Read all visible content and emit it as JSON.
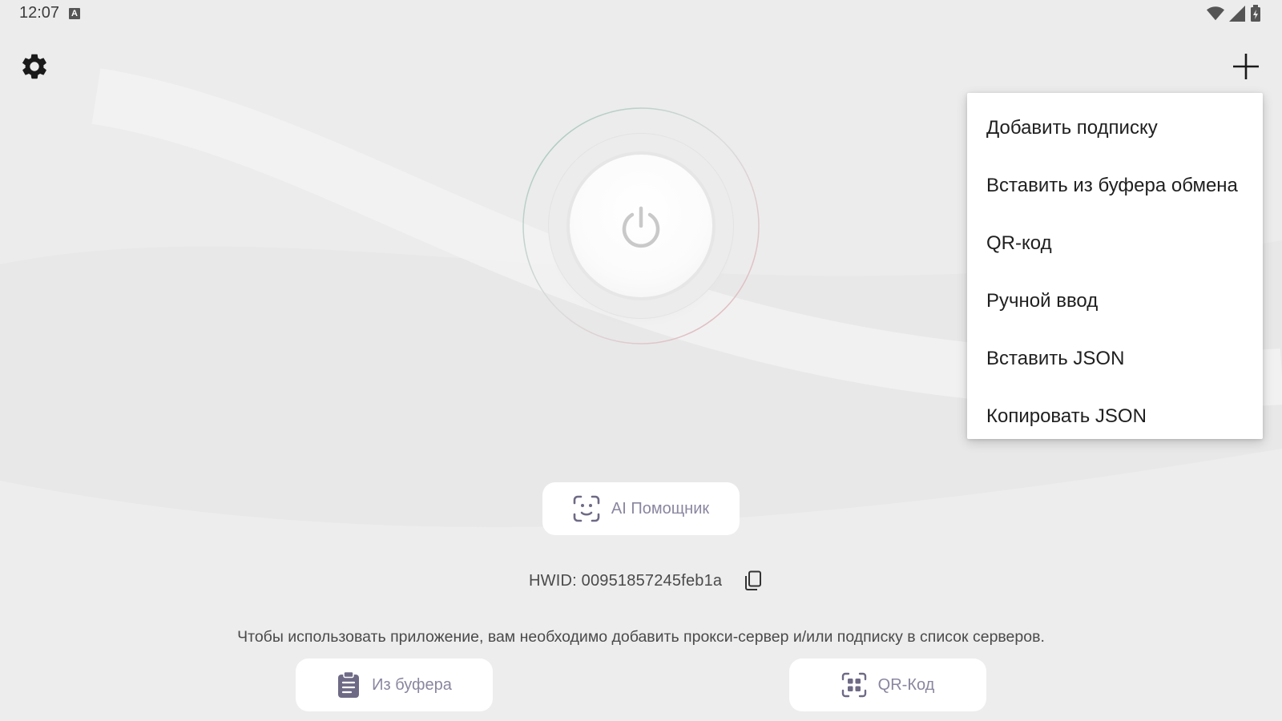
{
  "status_bar": {
    "time": "12:07",
    "notification_badge": "A",
    "icons": [
      "wifi-icon",
      "signal-icon",
      "battery-charging-icon"
    ]
  },
  "toolbar": {
    "settings_icon": "gear-icon",
    "add_icon": "plus-icon"
  },
  "power": {
    "icon": "power-icon"
  },
  "ai_assistant": {
    "label": "AI Помощник",
    "icon": "face-scan-icon"
  },
  "hwid": {
    "text": "HWID: 00951857245feb1a",
    "copy_icon": "copy-icon"
  },
  "hint": "Чтобы использовать приложение, вам необходимо добавить прокси-сервер и/или подписку в список серверов.",
  "bottom_buttons": {
    "clipboard": {
      "label": "Из буфера",
      "icon": "clipboard-icon"
    },
    "qr": {
      "label": "QR-Код",
      "icon": "qr-scan-icon"
    }
  },
  "add_menu": {
    "items": [
      {
        "label": "Добавить подписку"
      },
      {
        "label": "Вставить из буфера обмена"
      },
      {
        "label": "QR-код"
      },
      {
        "label": "Ручной ввод"
      },
      {
        "label": "Вставить JSON"
      },
      {
        "label": "Копировать JSON"
      }
    ]
  },
  "colors": {
    "background": "#ececec",
    "accent_muted": "#8a86a0",
    "ring_green": "#9fc7b8",
    "ring_pink": "#e3b2b9"
  }
}
